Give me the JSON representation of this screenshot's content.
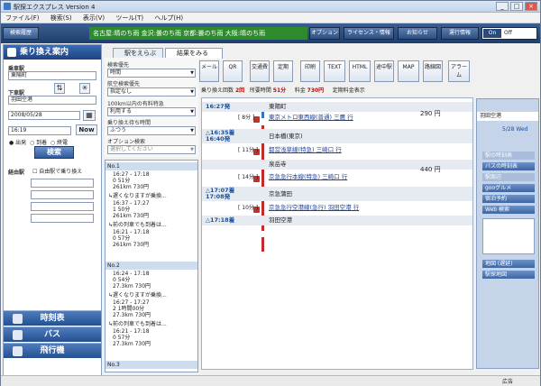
{
  "window": {
    "title": "駅探エクスプレス Version 4",
    "controls": [
      "_",
      "□",
      "×"
    ]
  },
  "menu": [
    "ファイル(F)",
    "検索(S)",
    "表示(V)",
    "ツール(T)",
    "ヘルプ(H)"
  ],
  "topbar": {
    "news_button": "検索履歴",
    "ticker": "名古屋:晴のち雨  金沢:曇のち雨  京都:曇のち雨  大阪:晴のち雨",
    "buttons": [
      "オプション",
      "ライセンス・情報",
      "お知らせ",
      "運行情報"
    ],
    "onoff": {
      "on": "On",
      "off": "Off"
    }
  },
  "left": {
    "header": "乗り換え案内",
    "from_label": "乗車駅",
    "from_value": "東陽町",
    "to_label": "下車駅",
    "to_value": "羽田空港",
    "date": "2008/05/28",
    "time": "16:19",
    "now_button": "Now",
    "radio": [
      "出発",
      "到着",
      "終電"
    ],
    "search_button": "検索",
    "via_label": "経由駅",
    "via_check": "自由駅で乗り換え",
    "nav": [
      "時刻表",
      "バス",
      "飛行機"
    ]
  },
  "tabs": [
    "駅をえらぶ",
    "結果をみる"
  ],
  "options": {
    "sort_label": "検索優先",
    "sort_value": "時間",
    "air_label": "航空検索優先",
    "air_value": "指定なし",
    "express_label": "100km以内の有料特急",
    "express_value": "利用する",
    "transfer_label": "乗り換え待ち時間",
    "transfer_value": "ふつう",
    "option_label": "オプション検索",
    "option_value": "選択してください"
  },
  "results": [
    {
      "head": "No.1",
      "lines": [
        "16:27 - 17:18",
        "0 51分",
        "261km 730円",
        "↳遅くなりますが乗換...",
        "16:37 - 17:27",
        "1 50分",
        "261km 730円",
        "↳前の列車でも到着は...",
        "16:21 - 17:18",
        "0 57分",
        "261km 730円"
      ]
    },
    {
      "head": "No.2",
      "lines": [
        "16:24 - 17:18",
        "0 54分",
        "27.3km 730円",
        "↳遅くなりますが乗換...",
        "16:27 - 17:27",
        "2 1時間00分",
        "27.3km 730円",
        "↳前の列車でも到着は...",
        "16:21 - 17:18",
        "0 57分",
        "27.3km 730円"
      ]
    },
    {
      "head": "No.3",
      "lines": []
    }
  ],
  "toolbar": [
    "メール",
    "QR",
    "交通費",
    "定期",
    "印刷",
    "TEXT",
    "HTML",
    "途中駅",
    "MAP",
    "路線図",
    "アラーム"
  ],
  "summary": {
    "transfers_label": "乗り換え回数",
    "transfers": "2回",
    "duration_label": "所要時間",
    "duration": "51分",
    "fare_label": "料金",
    "fare": "730円",
    "commuter": "定期料金表示"
  },
  "route": {
    "stops": [
      {
        "time": "16:27発",
        "name": "東陽町"
      },
      {
        "time": "△16:35着\n16:40発",
        "name": "日本橋(東京)"
      },
      {
        "time": "",
        "name": "泉岳寺"
      },
      {
        "time": "△17:07着\n17:08発",
        "name": "京急蒲田"
      },
      {
        "time": "△17:18着",
        "name": "羽田空港"
      }
    ],
    "segments": [
      {
        "mins": "[ 8分 ]",
        "line": "東京メトロ東西線(普通) 三鷹 行"
      },
      {
        "mins": "[ 11分 ]",
        "line": "都営浅草線(特急) 三崎口 行"
      },
      {
        "mins": "[ 14分 ]",
        "line": "京急急行本線(特急) 三崎口 行"
      },
      {
        "mins": "[ 10分 ]",
        "line": "京急急行空港線(急行) 羽田空港 行"
      }
    ],
    "fares": [
      "290 円",
      "440 円"
    ]
  },
  "info": {
    "station": "羽田空港",
    "date": "5/28 Wed",
    "buttons": [
      "駅の時刻表",
      "バスの時刻表",
      "駅周辺",
      "gooグルメ",
      "宿泊予約",
      "Web 検索",
      "地図 (遅延)",
      "駅探地図"
    ]
  },
  "status": "広告"
}
